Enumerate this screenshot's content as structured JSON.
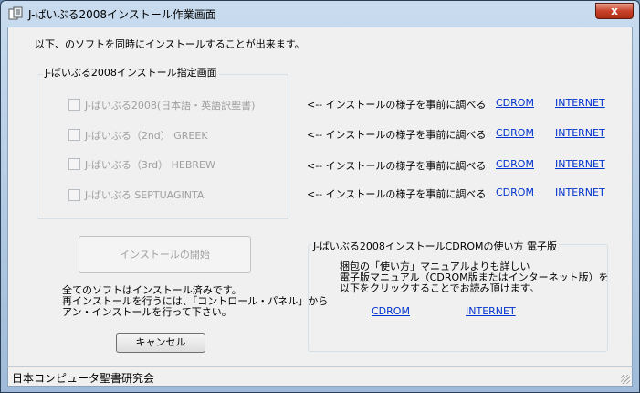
{
  "window": {
    "title": "J-ばいぶる2008インストール作業画面",
    "close_label": "x"
  },
  "intro_text": "以下、のソフトを同時にインストールすることが出来ます。",
  "install_group": {
    "label": "J-ばいぶる2008インストール指定画面",
    "items": [
      {
        "label": "J-ばいぶる2008(日本語・英語訳聖書)",
        "checked": false,
        "enabled": false,
        "hint": "<-- インストールの様子を事前に調べる",
        "cdrom": "CDROM",
        "internet": "INTERNET"
      },
      {
        "label": "J-ばいぶる（2nd） GREEK",
        "checked": false,
        "enabled": false,
        "hint": "<-- インストールの様子を事前に調べる",
        "cdrom": "CDROM",
        "internet": "INTERNET"
      },
      {
        "label": "J-ばいぶる（3rd） HEBREW",
        "checked": false,
        "enabled": false,
        "hint": "<-- インストールの様子を事前に調べる",
        "cdrom": "CDROM",
        "internet": "INTERNET"
      },
      {
        "label": "J-ばいぶる SEPTUAGINTA",
        "checked": false,
        "enabled": false,
        "hint": "<-- インストールの様子を事前に調べる",
        "cdrom": "CDROM",
        "internet": "INTERNET"
      }
    ]
  },
  "start_install_button": "インストールの開始",
  "status_message": {
    "line1": "全てのソフトはインストール済みです。",
    "line2": "再インストールを行うには、「コントロール・パネル」から",
    "line3": "アン・インストールを行って下さい。"
  },
  "cancel_button": "キャンセル",
  "manual_group": {
    "label": "J-ばいぶる2008インストールCDROMの使い方 電子版",
    "line1": "梱包の「使い方」マニュアルよりも詳しい",
    "line2": "電子版マニュアル（CDROM版またはインターネット版）を",
    "line3": "以下をクリックすることでお読み頂けます。",
    "cdrom_link": "CDROM",
    "internet_link": "INTERNET"
  },
  "statusbar": {
    "text": "日本コンピュータ聖書研究会"
  },
  "colors": {
    "link": "#0033cc",
    "disabled_text": "#a0a0a0",
    "dialog_bg": "#f0f0f0",
    "close_button": "#c8412a"
  },
  "icons": {
    "app": "installer-app-icon",
    "close": "close-icon",
    "resize": "resize-grip-icon"
  }
}
